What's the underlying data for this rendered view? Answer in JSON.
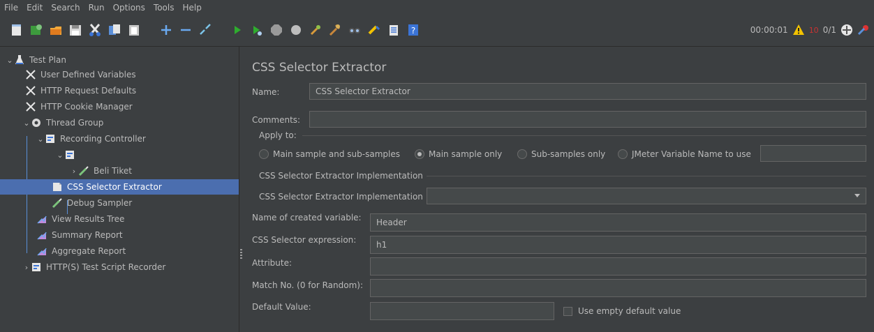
{
  "menu": [
    {
      "label": "File"
    },
    {
      "label": "Edit"
    },
    {
      "label": "Search"
    },
    {
      "label": "Run"
    },
    {
      "label": "Options"
    },
    {
      "label": "Tools"
    },
    {
      "label": "Help"
    }
  ],
  "toolbar": {
    "buttons": [
      "new-template-icon",
      "templates-icon",
      "open-icon",
      "save-icon",
      "cut-icon",
      "copy-icon",
      "paste-icon",
      "expand-icon",
      "collapse-icon",
      "toggle-icon",
      "start-icon",
      "start-no-pauses-icon",
      "stop-icon",
      "shutdown-icon",
      "clear-icon",
      "clear-all-icon",
      "search-icon",
      "reset-search-icon",
      "function-helper-icon",
      "help-icon"
    ],
    "timer": "00:00:01",
    "error_count": "10",
    "threads": "0/1",
    "colors": {
      "accent": "#4b6eaf",
      "run": "#2eac2e",
      "warn": "#f2c200"
    }
  },
  "tree": [
    {
      "label": "Test Plan",
      "icon": "test-plan-icon"
    },
    {
      "label": "User Defined Variables",
      "icon": "wrench-icon"
    },
    {
      "label": "HTTP Request Defaults",
      "icon": "wrench-icon"
    },
    {
      "label": "HTTP Cookie Manager",
      "icon": "wrench-icon"
    },
    {
      "label": "Thread Group",
      "icon": "gear-icon"
    },
    {
      "label": "Recording Controller",
      "icon": "controller-icon"
    },
    {
      "label": "",
      "icon": "controller-icon"
    },
    {
      "label": "Beli Tiket",
      "icon": "pipette-icon"
    },
    {
      "label": "CSS Selector Extractor",
      "icon": "extractor-icon"
    },
    {
      "label": "Debug Sampler",
      "icon": "pipette-icon"
    },
    {
      "label": "View Results Tree",
      "icon": "chart-icon"
    },
    {
      "label": "Summary Report",
      "icon": "chart-icon"
    },
    {
      "label": "Aggregate Report",
      "icon": "chart-icon"
    },
    {
      "label": "HTTP(S) Test Script Recorder",
      "icon": "controller-icon"
    }
  ],
  "panel": {
    "title": "CSS Selector Extractor",
    "name_label": "Name:",
    "name_value": "CSS Selector Extractor",
    "comments_label": "Comments:",
    "comments_value": "",
    "apply_to": "Apply to:",
    "radios": [
      {
        "label": "Main sample and sub-samples",
        "checked": false
      },
      {
        "label": "Main sample only",
        "checked": true
      },
      {
        "label": "Sub-samples only",
        "checked": false
      },
      {
        "label": "JMeter Variable Name to use",
        "checked": false
      }
    ],
    "jmeter_var_value": "",
    "impl_group": "CSS Selector Extractor Implementation",
    "impl_label": "CSS Selector Extractor Implementation",
    "impl_value": "",
    "var_label": "Name of created variable:",
    "var_value": "Header",
    "expr_label": "CSS Selector expression:",
    "expr_value": "h1",
    "attr_label": "Attribute:",
    "attr_value": "",
    "match_label": "Match No. (0 for Random):",
    "match_value": "",
    "default_label": "Default Value:",
    "default_value": "",
    "empty_default_label": "Use empty default value"
  }
}
